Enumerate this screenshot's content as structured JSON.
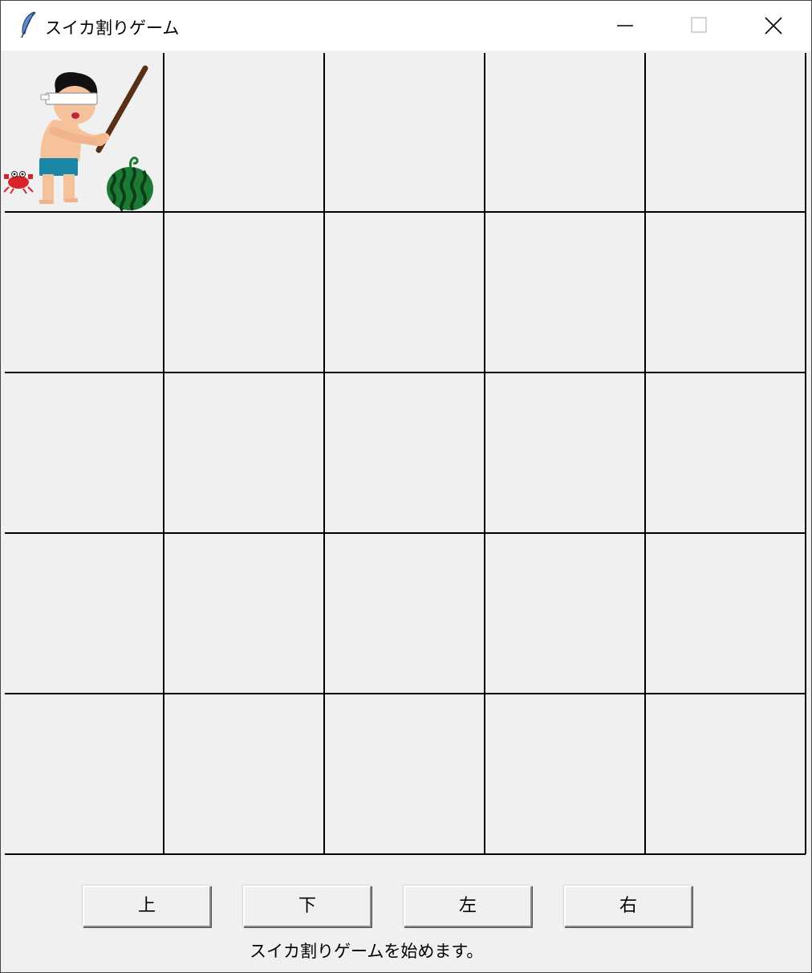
{
  "window": {
    "title": "スイカ割りゲーム",
    "icon": "feather-icon",
    "controls": [
      "minimize-icon",
      "maximize-icon",
      "close-icon"
    ]
  },
  "board": {
    "rows": 5,
    "cols": 5,
    "player_cell": [
      0,
      0
    ],
    "watermelon_cell": [
      0,
      0
    ],
    "crab_cell": [
      0,
      0
    ],
    "background": "#f0f0f0",
    "line_color": "#000000"
  },
  "controls": {
    "up_label": "上",
    "down_label": "下",
    "left_label": "左",
    "right_label": "右"
  },
  "status": {
    "message": "スイカ割りゲームを始めます。"
  }
}
